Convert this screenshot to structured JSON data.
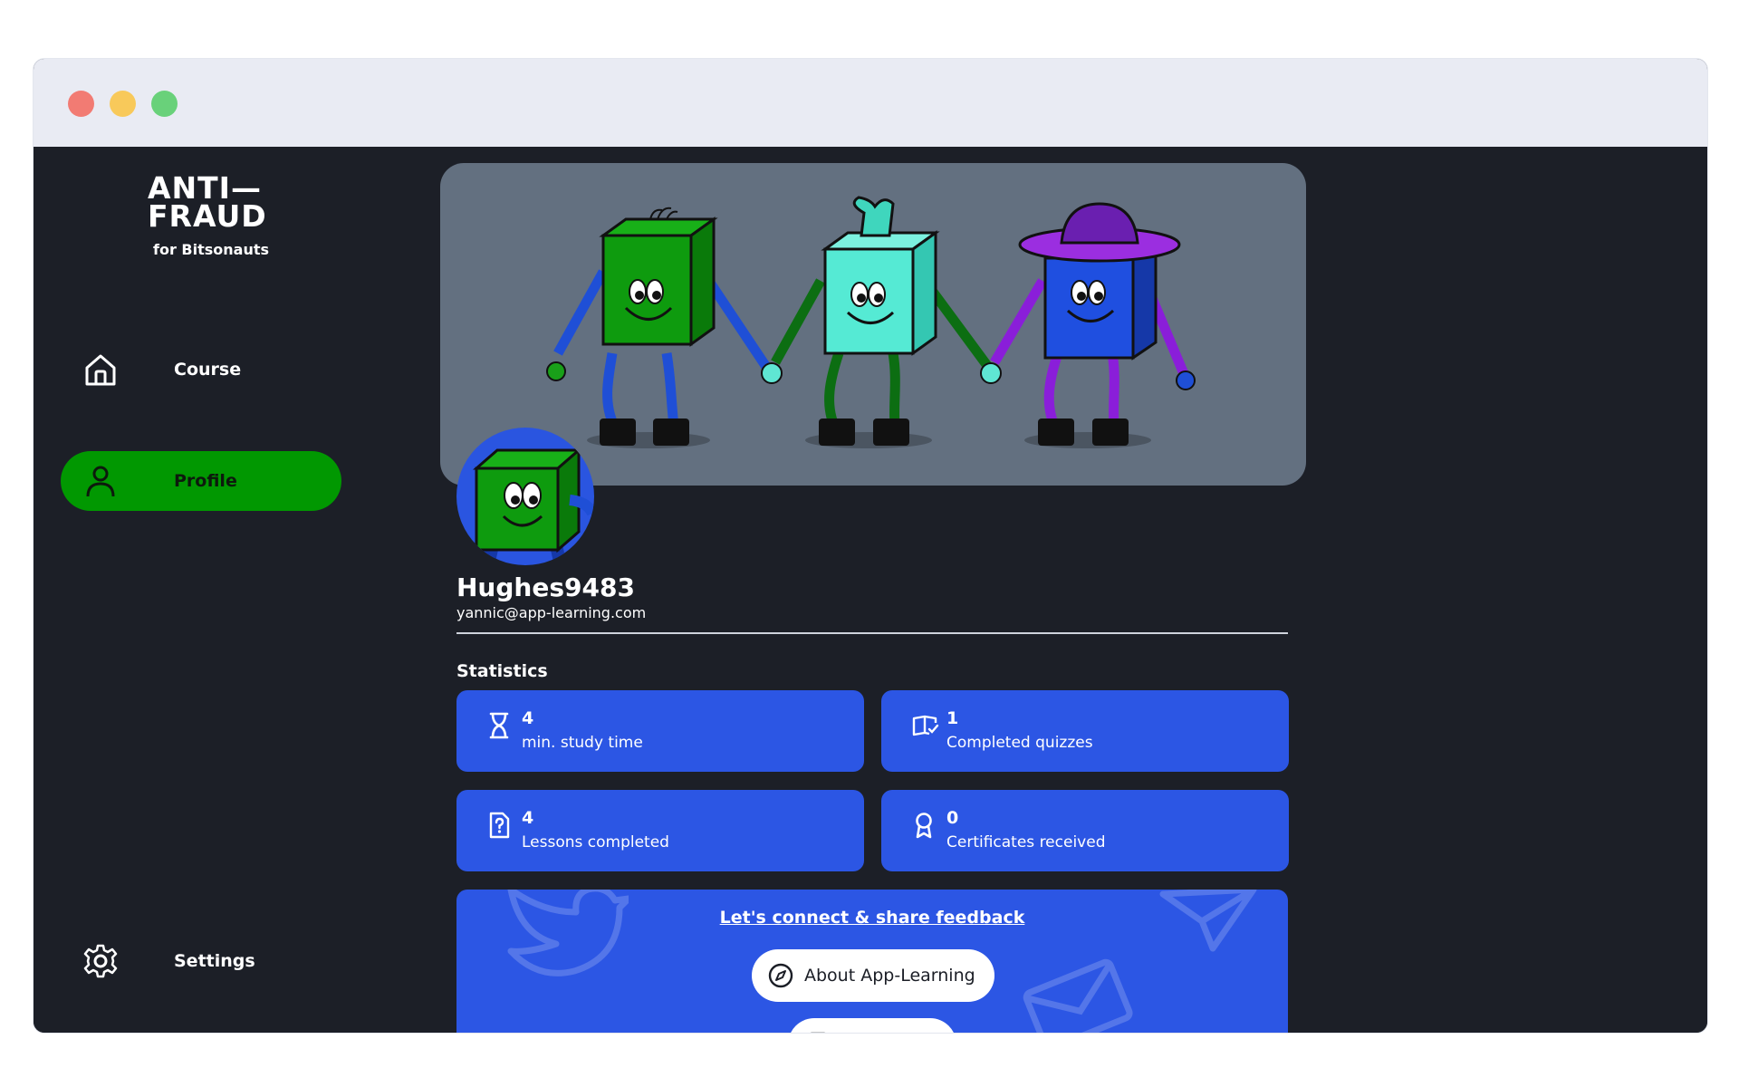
{
  "app": {
    "logo_title_line1": "ANTI—",
    "logo_title_line2": "FRAUD",
    "logo_subtitle": "for Bitsonauts"
  },
  "sidebar": {
    "items": [
      {
        "label": "Course",
        "icon": "home-icon",
        "active": false
      },
      {
        "label": "Profile",
        "icon": "user-icon",
        "active": true
      }
    ],
    "settings_label": "Settings"
  },
  "profile": {
    "username": "Hughes9483",
    "email": "yannic@app-learning.com"
  },
  "statistics": {
    "title": "Statistics",
    "cards": [
      {
        "value": "4",
        "label": "min. study time",
        "icon": "hourglass-icon"
      },
      {
        "value": "1",
        "label": "Completed quizzes",
        "icon": "book-check-icon"
      },
      {
        "value": "4",
        "label": "Lessons completed",
        "icon": "question-document-icon"
      },
      {
        "value": "0",
        "label": "Certificates received",
        "icon": "award-icon"
      }
    ]
  },
  "connect": {
    "link_text": "Let's connect & share feedback",
    "about_label": "About App-Learning"
  },
  "colors": {
    "background": "#1c1f27",
    "accent_green": "#019801",
    "card_blue": "#2c56e4",
    "banner_gray": "#637080"
  }
}
